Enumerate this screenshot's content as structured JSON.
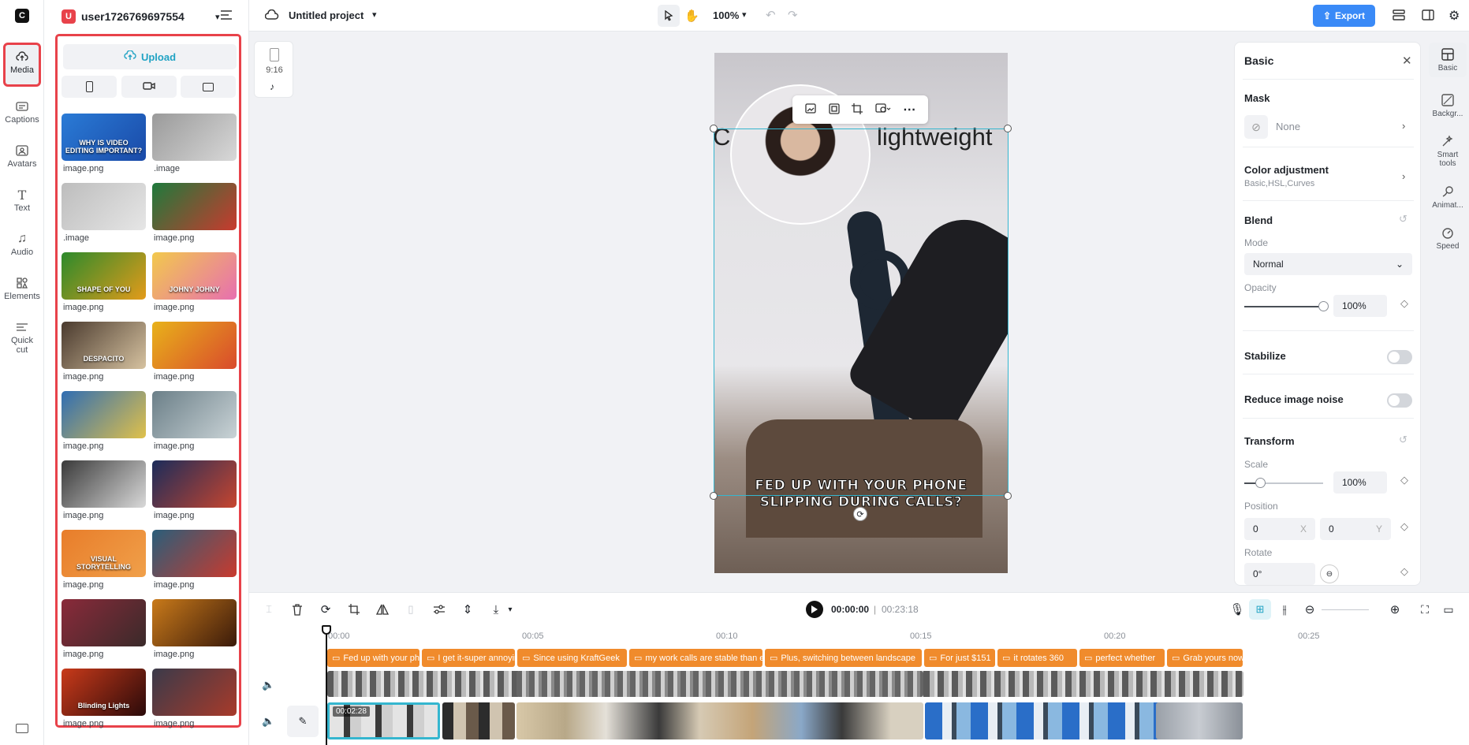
{
  "app": {
    "logo_letter": "C"
  },
  "rail": {
    "items": [
      {
        "label": "Media",
        "icon": "cloud-upload-icon"
      },
      {
        "label": "Captions",
        "icon": "captions-icon"
      },
      {
        "label": "Avatars",
        "icon": "avatar-icon"
      },
      {
        "label": "Text",
        "icon": "text-icon"
      },
      {
        "label": "Audio",
        "icon": "music-note-icon"
      },
      {
        "label": "Elements",
        "icon": "elements-icon"
      },
      {
        "label": "Quick cut",
        "icon": "scissors-icon"
      }
    ]
  },
  "panel": {
    "user_badge": "U",
    "user_name": "user1726769697554",
    "upload_label": "Upload",
    "thumbs": [
      {
        "label": "image.png",
        "color_a": "#2a7bd6",
        "color_b": "#1a4aa8",
        "overlay": "WHY IS VIDEO EDITING IMPORTANT?"
      },
      {
        "label": ".image",
        "color_a": "#9a9a9a",
        "color_b": "#d8d8d8",
        "overlay": ""
      },
      {
        "label": ".image",
        "color_a": "#bdbdbd",
        "color_b": "#e6e6e6",
        "overlay": ""
      },
      {
        "label": "image.png",
        "color_a": "#1e7a3c",
        "color_b": "#c93a2e",
        "overlay": ""
      },
      {
        "label": "image.png",
        "color_a": "#2c8a2c",
        "color_b": "#e39b1a",
        "overlay": "SHAPE OF YOU"
      },
      {
        "label": "image.png",
        "color_a": "#f2c94c",
        "color_b": "#e76fb0",
        "overlay": "JOHNY JOHNY"
      },
      {
        "label": "image.png",
        "color_a": "#4a3a2e",
        "color_b": "#d6c2a0",
        "overlay": "DESPACITO"
      },
      {
        "label": "image.png",
        "color_a": "#e8b21a",
        "color_b": "#d94a2c",
        "overlay": ""
      },
      {
        "label": "image.png",
        "color_a": "#2f6db3",
        "color_b": "#e0c14a",
        "overlay": ""
      },
      {
        "label": "image.png",
        "color_a": "#6b7f88",
        "color_b": "#c9d3d6",
        "overlay": ""
      },
      {
        "label": "image.png",
        "color_a": "#3a3a3a",
        "color_b": "#d9d9d9",
        "overlay": ""
      },
      {
        "label": "image.png",
        "color_a": "#1b2c5a",
        "color_b": "#c7452f",
        "overlay": ""
      },
      {
        "label": "image.png",
        "color_a": "#e87d2a",
        "color_b": "#f0a04a",
        "overlay": "VISUAL STORYTELLING"
      },
      {
        "label": "image.png",
        "color_a": "#2a5e7a",
        "color_b": "#c93a2e",
        "overlay": ""
      },
      {
        "label": "image.png",
        "color_a": "#8a2a3a",
        "color_b": "#3a2a2a",
        "overlay": ""
      },
      {
        "label": "image.png",
        "color_a": "#c97a1a",
        "color_b": "#3a1a0a",
        "overlay": ""
      },
      {
        "label": "image.png",
        "color_a": "#c93a1a",
        "color_b": "#2a0a0a",
        "overlay": "Blinding Lights"
      },
      {
        "label": "image.png",
        "color_a": "#3a3a4a",
        "color_b": "#a83a2a",
        "overlay": ""
      }
    ]
  },
  "topbar": {
    "project_title": "Untitled project",
    "zoom": "100%",
    "export_label": "Export"
  },
  "canvas": {
    "aspect_label": "9:16",
    "overlay_left": "C",
    "overlay_right": "lightweight",
    "caption_line1": "FED UP WITH YOUR PHONE",
    "caption_line2": "SLIPPING DURING CALLS?"
  },
  "props": {
    "title": "Basic",
    "mask_label": "Mask",
    "mask_value": "None",
    "color_adj_label": "Color adjustment",
    "color_adj_sub": "Basic,HSL,Curves",
    "blend_label": "Blend",
    "mode_label": "Mode",
    "mode_value": "Normal",
    "opacity_label": "Opacity",
    "opacity_value": "100%",
    "opacity_level": 1.0,
    "stabilize_label": "Stabilize",
    "noise_label": "Reduce image noise",
    "transform_label": "Transform",
    "scale_label": "Scale",
    "scale_value": "100%",
    "scale_level": 0.2,
    "position_label": "Position",
    "pos_x": "0",
    "pos_x_axis": "X",
    "pos_y": "0",
    "pos_y_axis": "Y",
    "rotate_label": "Rotate",
    "rotate_value": "0°"
  },
  "tabs": [
    {
      "label": "Basic",
      "icon": "basic-icon"
    },
    {
      "label": "Backgr...",
      "icon": "background-icon"
    },
    {
      "label": "Smart tools",
      "icon": "smart-tools-icon"
    },
    {
      "label": "Animat...",
      "icon": "animation-icon"
    },
    {
      "label": "Speed",
      "icon": "speed-icon"
    }
  ],
  "timeline": {
    "current_time": "00:00:00",
    "total_time": "00:23:18",
    "ruler": [
      "00:00",
      "00:05",
      "00:10",
      "00:15",
      "00:20",
      "00:25"
    ],
    "clip_duration": "00:02:28",
    "captions": [
      "Fed up with your phone",
      "I get it-super annoying",
      "Since using KraftGeek",
      "my work calls are stable than ever",
      "Plus, switching between landscape",
      "For just $151",
      "it rotates 360",
      "perfect whether",
      "Grab yours now"
    ]
  }
}
